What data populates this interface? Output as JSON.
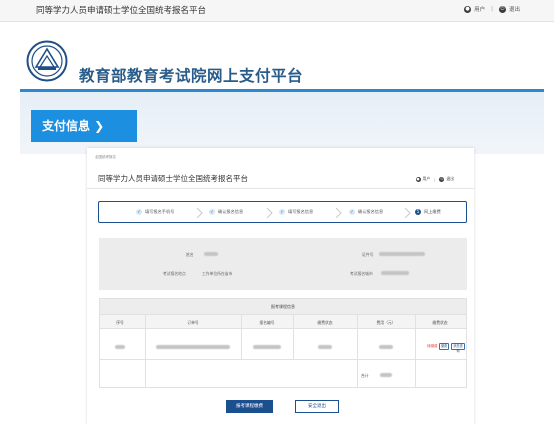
{
  "outer": {
    "title": "同等学力人员申请硕士学位全国统考报名平台",
    "user_label": "用户",
    "logout_label": "退出"
  },
  "brand": {
    "name": "教育部教育考试院网上支付平台"
  },
  "pay_button": {
    "label": "支付信息 ❯"
  },
  "inner": {
    "breadcrumb": "全国统考报名",
    "title": "同等学力人员申请硕士学位全国统考报名平台",
    "user_label": "用户",
    "logout_label": "退出",
    "steps": [
      {
        "label": "填写报名手机号",
        "done": true
      },
      {
        "label": "确认报名信息",
        "done": true
      },
      {
        "label": "填写报名信息",
        "done": true
      },
      {
        "label": "确认报名信息",
        "done": true
      },
      {
        "label": "网上缴费",
        "number": "5",
        "done": false
      }
    ],
    "info": {
      "name_label": "姓名",
      "id_label": "证件号",
      "place_label": "考试报名地点",
      "place_value": "工作单位所在省市",
      "city_label": "考试报名城市"
    },
    "table": {
      "title": "报考课程信息",
      "headers": [
        "序号",
        "订单号",
        "报名编号",
        "缴费状态",
        "费用（元）",
        "缴费状态"
      ],
      "status_text": "待缴费",
      "btn_pay": "缴费",
      "btn_query": "状态查询",
      "total_label": "合计"
    },
    "confirm_label": "报考课程缴费",
    "logout_button": "安全退出"
  }
}
